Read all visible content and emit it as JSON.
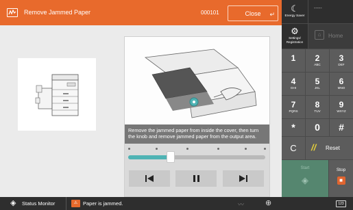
{
  "header": {
    "title": "Remove Jammed Paper",
    "job_number": "000101",
    "close_label": "Close",
    "return_symbol": "↵",
    "color": "#e86a2c"
  },
  "instruction": {
    "caption": "Remove the jammed paper from inside the cover, then turn the knob and remove jammed paper from the output area.",
    "progress": 0.31,
    "step_markers": 6,
    "controls": {
      "previous_icon": "skip-previous-icon",
      "pause_icon": "pause-icon",
      "next_icon": "skip-next-icon"
    },
    "accent_color": "#4fb3b4"
  },
  "sidebar": {
    "energy_saver": {
      "label": "Energy Saver",
      "icon": "moon-icon"
    },
    "login_text": "-----",
    "settings": {
      "label_line1": "Settings/",
      "label_line2": "Registration",
      "icon": "gear-icon"
    },
    "home": {
      "label": "Home",
      "icon": "home-icon"
    },
    "keypad": [
      {
        "digit": "1",
        "letters": ""
      },
      {
        "digit": "2",
        "letters": "ABC"
      },
      {
        "digit": "3",
        "letters": "DEF"
      },
      {
        "digit": "4",
        "letters": "GHI"
      },
      {
        "digit": "5",
        "letters": "JKL"
      },
      {
        "digit": "6",
        "letters": "MNO"
      },
      {
        "digit": "7",
        "letters": "PQRS"
      },
      {
        "digit": "8",
        "letters": "TUV"
      },
      {
        "digit": "9",
        "letters": "WXYZ"
      },
      {
        "digit": "*",
        "letters": ""
      },
      {
        "digit": "0",
        "letters": ""
      },
      {
        "digit": "#",
        "letters": ""
      }
    ],
    "clear_label": "C",
    "reset_label": "Reset",
    "start_label": "Start",
    "stop_label": "Stop"
  },
  "status_bar": {
    "status_monitor_label": "Status Monitor",
    "message": "Paper is jammed.",
    "keyboard_icon_text": "123"
  }
}
